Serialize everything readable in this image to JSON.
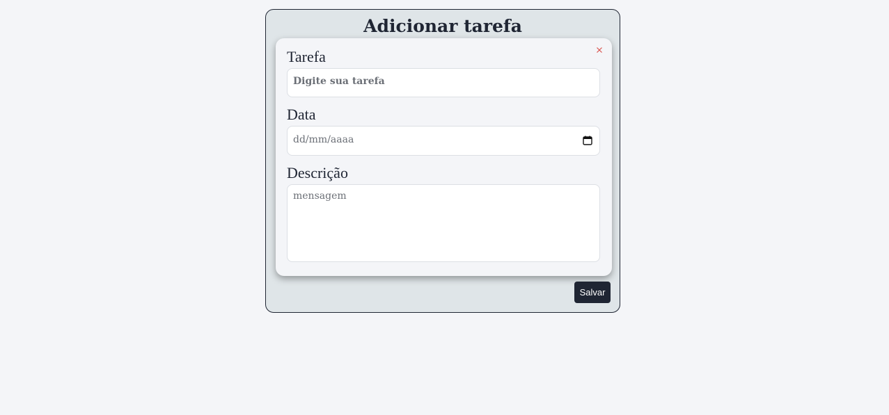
{
  "modal": {
    "title": "Adicionar tarefa",
    "close_icon": "close-icon",
    "close_color": "#d9534f"
  },
  "form": {
    "task_label": "Tarefa",
    "task_placeholder": "Digite sua tarefa",
    "date_label": "Data",
    "date_placeholder": "dd/mm/aaaa",
    "date_icon": "calendar-icon",
    "description_label": "Descrição",
    "description_placeholder": "mensagem"
  },
  "actions": {
    "save_label": "Salvar"
  },
  "colors": {
    "page_bg": "#f4f5f8",
    "panel_bg": "#dfe5e8",
    "dark": "#1f2533"
  }
}
